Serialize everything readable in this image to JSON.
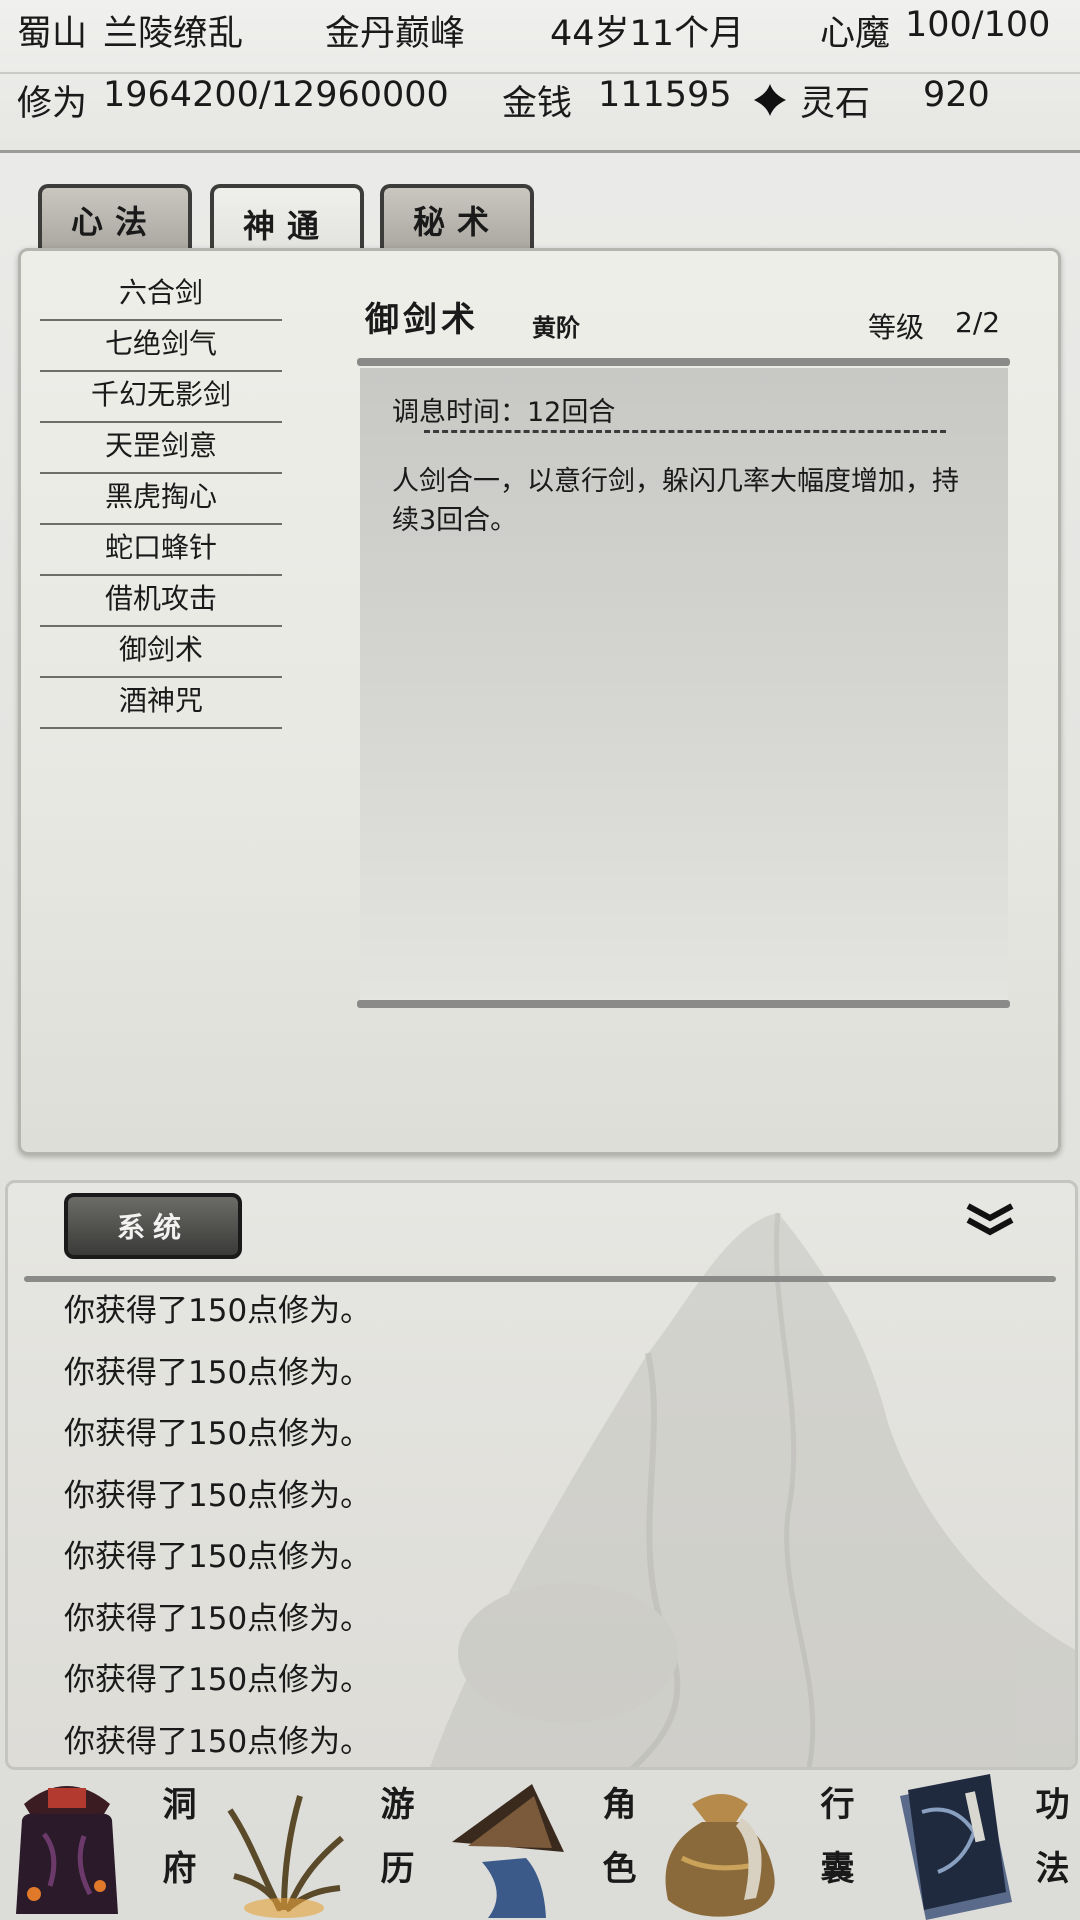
{
  "header": {
    "sect": "蜀山",
    "name": "兰陵缭乱",
    "realm": "金丹巅峰",
    "age": "44岁11个月",
    "demon_label": "心魔",
    "demon_value": "100/100",
    "cultivation_label": "修为",
    "cultivation_value": "1964200/12960000",
    "money_label": "金钱",
    "money_value": "111595",
    "stone_label": "灵石",
    "stone_value": "920"
  },
  "tabs": [
    {
      "label": "心法",
      "active": false
    },
    {
      "label": "神通",
      "active": true
    },
    {
      "label": "秘术",
      "active": false
    }
  ],
  "skills": [
    {
      "label": "六合剑"
    },
    {
      "label": "七绝剑气"
    },
    {
      "label": "千幻无影剑"
    },
    {
      "label": "天罡剑意"
    },
    {
      "label": "黑虎掏心"
    },
    {
      "label": "蛇口蜂针"
    },
    {
      "label": "借机攻击"
    },
    {
      "label": "御剑术",
      "selected": true
    },
    {
      "label": "酒神咒"
    }
  ],
  "detail": {
    "name": "御剑术",
    "grade": "黄阶",
    "level_label": "等级",
    "level_value": "2/2",
    "cooldown": "调息时间：12回合",
    "description": "人剑合一，以意行剑，躲闪几率大幅度增加，持续3回合。"
  },
  "log": {
    "channel": "系统",
    "lines": [
      "你获得了150点修为。",
      "你获得了150点修为。",
      "你获得了150点修为。",
      "你获得了150点修为。",
      "你获得了150点修为。",
      "你获得了150点修为。",
      "你获得了150点修为。",
      "你获得了150点修为。"
    ]
  },
  "nav": [
    {
      "label": "洞府",
      "icon": "cave-mansion-icon"
    },
    {
      "label": "游历",
      "icon": "travel-grass-icon"
    },
    {
      "label": "角色",
      "icon": "character-hat-icon"
    },
    {
      "label": "行囊",
      "icon": "bag-icon"
    },
    {
      "label": "功法",
      "icon": "manual-book-icon",
      "active": true
    }
  ],
  "colors": {
    "selected_highlight": "#6b3a46",
    "button_dark": "#3a3a38"
  }
}
